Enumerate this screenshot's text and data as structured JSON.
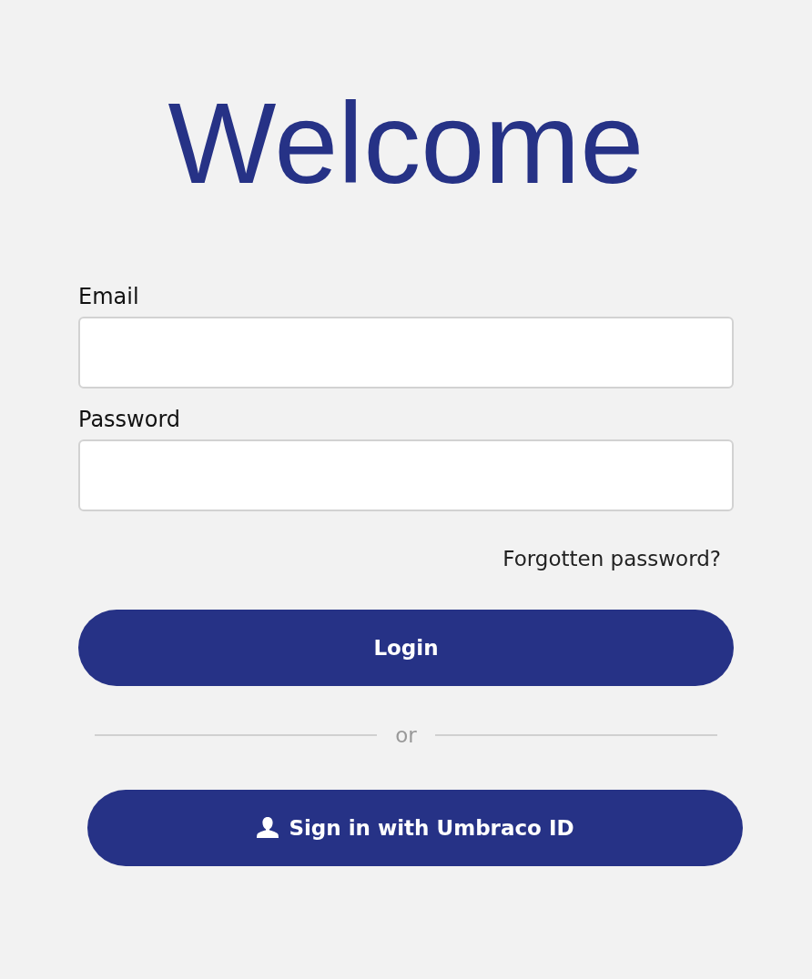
{
  "title": "Welcome",
  "fields": [
    {
      "label": "Email"
    },
    {
      "label": "Password"
    }
  ],
  "forgot_link": "Forgotten password?",
  "login_button": "Login",
  "divider_text": "or",
  "sso_button": "Sign in with Umbraco ID"
}
